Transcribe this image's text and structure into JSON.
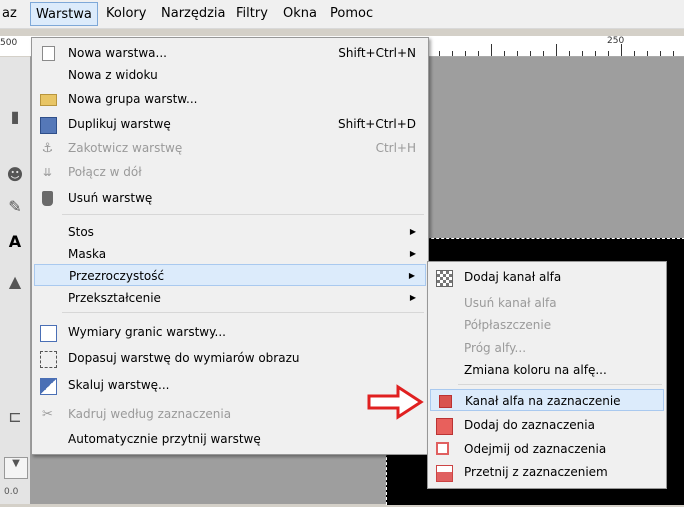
{
  "menubar": {
    "items": [
      "az",
      "Warstwa",
      "Kolory",
      "Narzędzia",
      "Filtry",
      "Okna",
      "Pomoc"
    ],
    "active": "Warstwa"
  },
  "ruler": {
    "left_label": "500",
    "mark_label": "250"
  },
  "main_menu": {
    "items": [
      {
        "label": "Nowa warstwa...",
        "shortcut": "Shift+Ctrl+N",
        "icon": "new-layer-icon",
        "enabled": true
      },
      {
        "label": "Nowa z widoku",
        "shortcut": "",
        "icon": "",
        "enabled": true
      },
      {
        "label": "Nowa grupa warstw...",
        "shortcut": "",
        "icon": "folder-icon",
        "enabled": true
      },
      {
        "label": "Duplikuj warstwę",
        "shortcut": "Shift+Ctrl+D",
        "icon": "duplicate-icon",
        "enabled": true
      },
      {
        "label": "Zakotwicz warstwę",
        "shortcut": "Ctrl+H",
        "icon": "anchor-icon",
        "enabled": false
      },
      {
        "label": "Połącz w dół",
        "shortcut": "",
        "icon": "merge-down-icon",
        "enabled": false
      },
      {
        "label": "Usuń warstwę",
        "shortcut": "",
        "icon": "trash-icon",
        "enabled": true
      },
      {
        "label": "Stos",
        "submenu": true
      },
      {
        "label": "Maska",
        "submenu": true
      },
      {
        "label": "Przezroczystość",
        "submenu": true,
        "highlighted": true
      },
      {
        "label": "Przekształcenie",
        "submenu": true
      },
      {
        "label": "Wymiary granic warstwy...",
        "icon": "layer-size-icon",
        "enabled": true
      },
      {
        "label": "Dopasuj warstwę do wymiarów obrazu",
        "icon": "fit-layer-icon",
        "enabled": true
      },
      {
        "label": "Skaluj warstwę...",
        "icon": "scale-layer-icon",
        "enabled": true
      },
      {
        "label": "Kadruj według zaznaczenia",
        "icon": "crop-icon",
        "enabled": false
      },
      {
        "label": "Automatycznie przytnij warstwę",
        "icon": "",
        "enabled": true
      }
    ]
  },
  "sub_menu": {
    "items": [
      {
        "label": "Dodaj kanał alfa",
        "icon": "checker-icon",
        "enabled": true
      },
      {
        "label": "Usuń kanał alfa",
        "enabled": false
      },
      {
        "label": "Półpłaszczenie",
        "enabled": false
      },
      {
        "label": "Próg alfy...",
        "enabled": false
      },
      {
        "label": "Zmiana koloru na alfę...",
        "enabled": true
      },
      {
        "label": "Kanał alfa na zaznaczenie",
        "icon": "alpha-to-selection-icon",
        "enabled": true,
        "highlighted": true
      },
      {
        "label": "Dodaj do zaznaczenia",
        "icon": "add-selection-icon",
        "enabled": true
      },
      {
        "label": "Odejmij od zaznaczenia",
        "icon": "subtract-selection-icon",
        "enabled": true
      },
      {
        "label": "Przetnij z zaznaczeniem",
        "icon": "intersect-selection-icon",
        "enabled": true
      }
    ]
  },
  "toolbox": {
    "bottom_value": "0.0"
  },
  "colors": {
    "highlight": "#dcebfb",
    "arrow": "#e02020"
  }
}
